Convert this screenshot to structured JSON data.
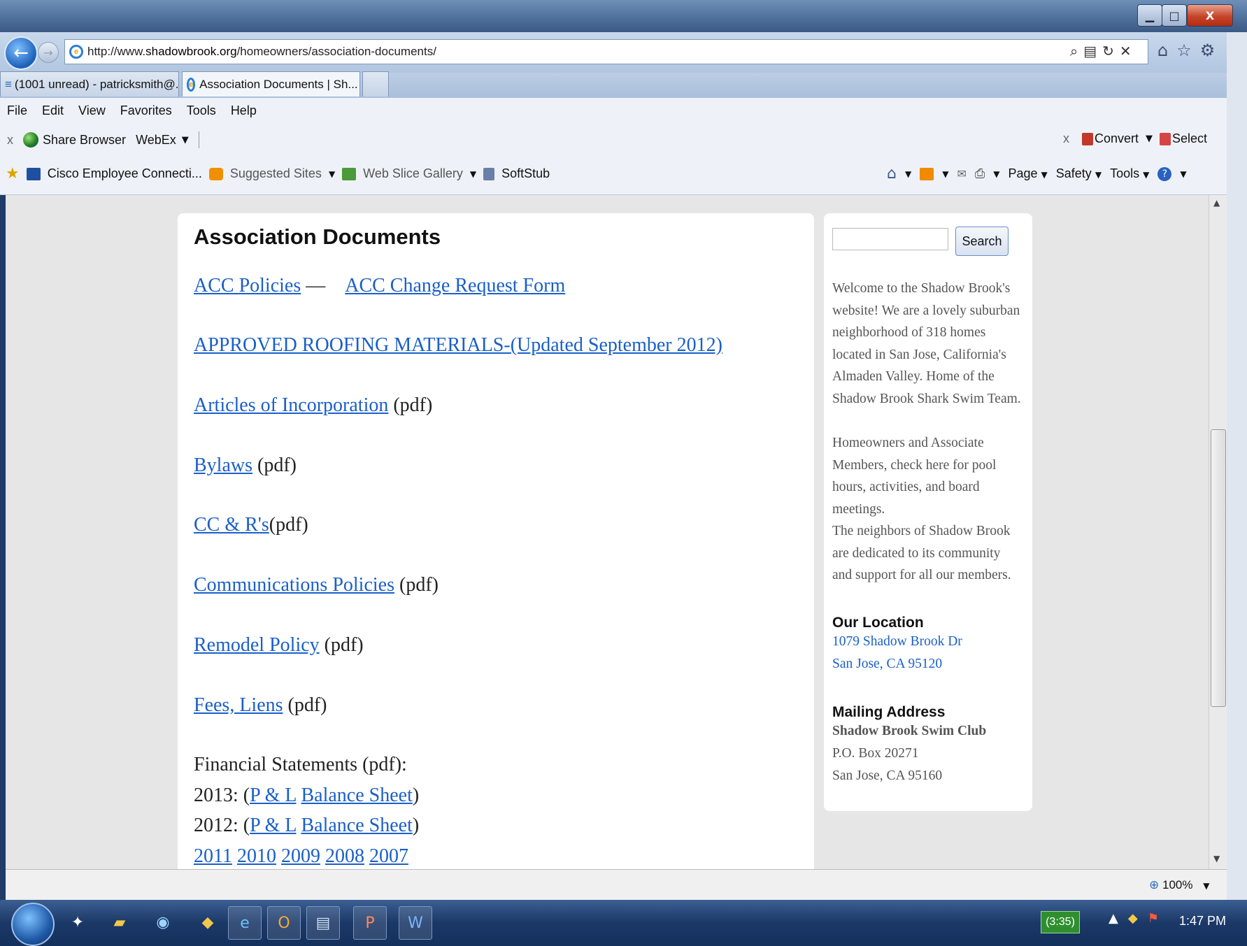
{
  "browser": {
    "url_prefix": "http://www.",
    "url_domain": "shadowbrook.org",
    "url_path": "/homeowners/association-documents/",
    "tabs": [
      {
        "label": "(1001 unread) - patricksmith@..."
      },
      {
        "label": "Association Documents | Sh..."
      }
    ],
    "menu": [
      "File",
      "Edit",
      "View",
      "Favorites",
      "Tools",
      "Help"
    ],
    "cmdbar": {
      "close": "x",
      "share": "Share Browser",
      "webex": "WebEx"
    },
    "favorites": {
      "cisco": "Cisco Employee Connecti...",
      "suggested": "Suggested Sites",
      "webslice": "Web Slice Gallery",
      "softstub": "SoftStub"
    },
    "right_cmd": {
      "close": "x",
      "convert": "Convert",
      "select": "Select"
    },
    "tools": {
      "page": "Page",
      "safety": "Safety",
      "tools": "Tools"
    },
    "zoom": "100%"
  },
  "main": {
    "title": "Association Documents",
    "acc_policies": "ACC Policies",
    "dash": " — ",
    "acc_change": "ACC Change Request Form",
    "roofing": "APPROVED ROOFING MATERIALS-(Updated September 2012)",
    "articles": "Articles of Incorporation",
    "articles_suffix": " (pdf)",
    "bylaws": "Bylaws",
    "bylaws_suffix": " (pdf)",
    "ccrs": "CC & R's",
    "ccrs_suffix": "(pdf)",
    "comm": "Communications Policies",
    "comm_suffix": " (pdf)",
    "remodel": "Remodel Policy",
    "remodel_suffix": " (pdf)",
    "fees": "Fees, Liens",
    "fees_suffix": " (pdf)",
    "financial": "Financial Statements (pdf):",
    "y2013": "2013: (",
    "y2012": "2012: (",
    "pl": "P & L",
    "balance": "Balance Sheet",
    "close_paren": ")",
    "years": [
      "2011",
      "2010",
      "2009",
      "2008",
      "2007"
    ]
  },
  "sidebar": {
    "search_button": "Search",
    "welcome": "Welcome to the Shadow Brook's website! We are a lovely suburban neighborhood of 318 homes located in San Jose, California's Almaden Valley. Home of the Shadow Brook Shark Swim Team.",
    "homeowners": "Homeowners and Associate Members, check here for pool hours, activities, and board meetings.",
    "neighbors": "The neighbors of Shadow Brook are dedicated to its community and support for all our members.",
    "location_heading": "Our Location",
    "location_line1": "1079 Shadow Brook Dr",
    "location_line2": "San Jose, CA 95120",
    "mailing_heading": "Mailing Address",
    "mailing_name": "Shadow Brook Swim Club",
    "mailing_box": "P.O. Box 20271",
    "mailing_city": "San Jose, CA 95160"
  },
  "taskbar": {
    "battery": "(3:35)",
    "clock": "1:47 PM"
  }
}
